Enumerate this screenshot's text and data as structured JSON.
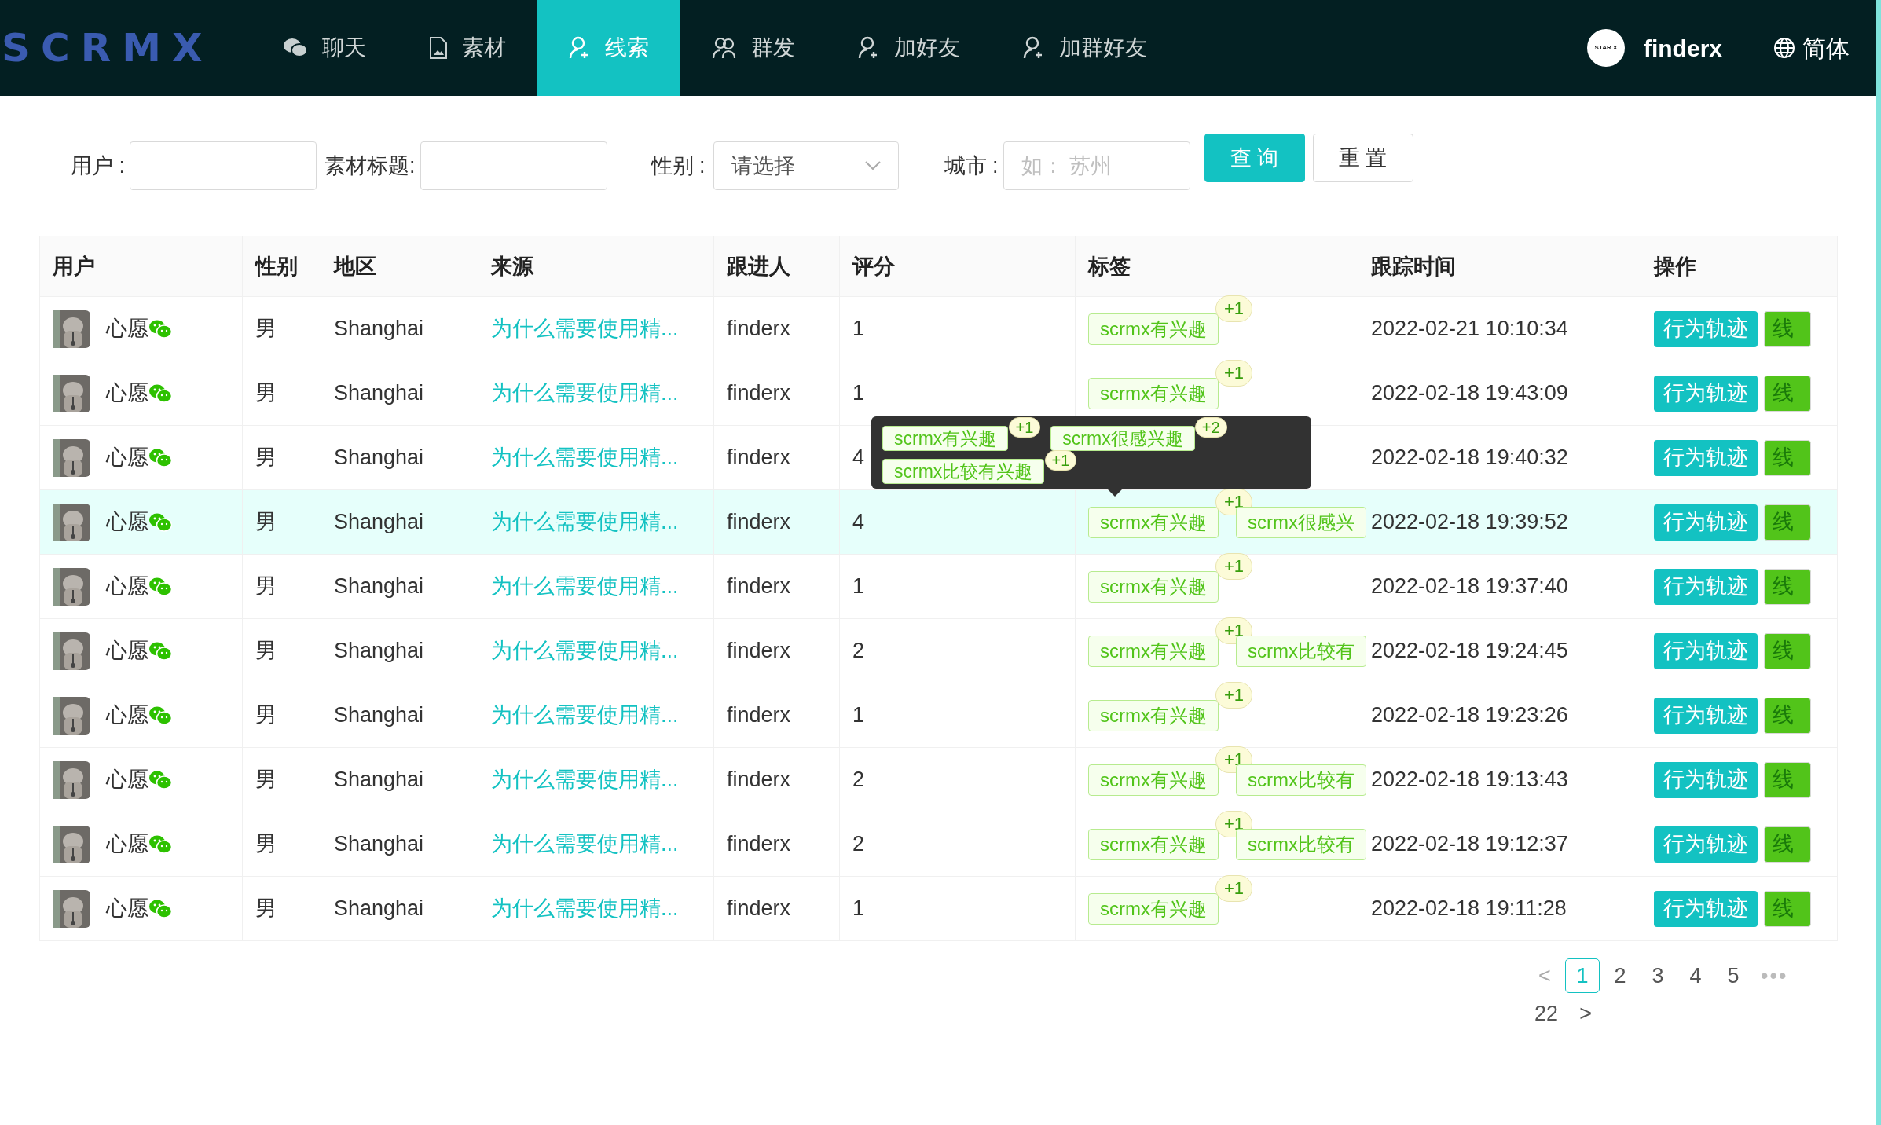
{
  "header": {
    "logo": "SCRMX",
    "nav": [
      {
        "label": "聊天",
        "selected": false
      },
      {
        "label": "素材",
        "selected": false
      },
      {
        "label": "线索",
        "selected": true
      },
      {
        "label": "群发",
        "selected": false
      },
      {
        "label": "加好友",
        "selected": false
      },
      {
        "label": "加群好友",
        "selected": false
      }
    ],
    "avatar_text": "STAR X",
    "user": "finderx",
    "language": "简体"
  },
  "filters": {
    "fields": [
      {
        "kind": "input",
        "label": "用户 :"
      },
      {
        "kind": "input",
        "label": "素材标题:"
      },
      {
        "kind": "select",
        "label": "性别 :",
        "value": "请选择"
      },
      {
        "kind": "input",
        "label": "城市 :",
        "placeholder": "如： 苏州"
      }
    ],
    "buttons": [
      "查 询",
      "重 置"
    ]
  },
  "table": {
    "columns": [
      "用户",
      "性别",
      "地区",
      "来源",
      "跟进人",
      "评分",
      "标签",
      "跟踪时间",
      "操作"
    ],
    "rows": [
      {
        "user": "心愿",
        "gender": "男",
        "region": "Shanghai",
        "source": "为什么需要使用精...",
        "follower": "finderx",
        "score": "1",
        "tags": [
          {
            "text": "scrmx有兴趣",
            "count": "+1"
          }
        ],
        "time": "2022-02-21 10:10:34",
        "actions": [
          "行为轨迹",
          "线"
        ],
        "highlighted": false
      },
      {
        "user": "心愿",
        "gender": "男",
        "region": "Shanghai",
        "source": "为什么需要使用精...",
        "follower": "finderx",
        "score": "1",
        "tags": [
          {
            "text": "scrmx有兴趣",
            "count": "+1"
          }
        ],
        "time": "2022-02-18 19:43:09",
        "actions": [
          "行为轨迹",
          "线"
        ],
        "highlighted": false
      },
      {
        "user": "心愿",
        "gender": "男",
        "region": "Shanghai",
        "source": "为什么需要使用精...",
        "follower": "finderx",
        "score": "4",
        "tags": [],
        "time": "2022-02-18 19:40:32",
        "actions": [
          "行为轨迹",
          "线"
        ],
        "highlighted": false
      },
      {
        "user": "心愿",
        "gender": "男",
        "region": "Shanghai",
        "source": "为什么需要使用精...",
        "follower": "finderx",
        "score": "4",
        "tags": [
          {
            "text": "scrmx有兴趣",
            "count": "+1"
          },
          {
            "text": "scrmx很感兴"
          }
        ],
        "time": "2022-02-18 19:39:52",
        "actions": [
          "行为轨迹",
          "线"
        ],
        "highlighted": true
      },
      {
        "user": "心愿",
        "gender": "男",
        "region": "Shanghai",
        "source": "为什么需要使用精...",
        "follower": "finderx",
        "score": "1",
        "tags": [
          {
            "text": "scrmx有兴趣",
            "count": "+1"
          }
        ],
        "time": "2022-02-18 19:37:40",
        "actions": [
          "行为轨迹",
          "线"
        ],
        "highlighted": false
      },
      {
        "user": "心愿",
        "gender": "男",
        "region": "Shanghai",
        "source": "为什么需要使用精...",
        "follower": "finderx",
        "score": "2",
        "tags": [
          {
            "text": "scrmx有兴趣",
            "count": "+1"
          },
          {
            "text": "scrmx比较有"
          }
        ],
        "time": "2022-02-18 19:24:45",
        "actions": [
          "行为轨迹",
          "线"
        ],
        "highlighted": false
      },
      {
        "user": "心愿",
        "gender": "男",
        "region": "Shanghai",
        "source": "为什么需要使用精...",
        "follower": "finderx",
        "score": "1",
        "tags": [
          {
            "text": "scrmx有兴趣",
            "count": "+1"
          }
        ],
        "time": "2022-02-18 19:23:26",
        "actions": [
          "行为轨迹",
          "线"
        ],
        "highlighted": false
      },
      {
        "user": "心愿",
        "gender": "男",
        "region": "Shanghai",
        "source": "为什么需要使用精...",
        "follower": "finderx",
        "score": "2",
        "tags": [
          {
            "text": "scrmx有兴趣",
            "count": "+1"
          },
          {
            "text": "scrmx比较有"
          }
        ],
        "time": "2022-02-18 19:13:43",
        "actions": [
          "行为轨迹",
          "线"
        ],
        "highlighted": false
      },
      {
        "user": "心愿",
        "gender": "男",
        "region": "Shanghai",
        "source": "为什么需要使用精...",
        "follower": "finderx",
        "score": "2",
        "tags": [
          {
            "text": "scrmx有兴趣",
            "count": "+1"
          },
          {
            "text": "scrmx比较有"
          }
        ],
        "time": "2022-02-18 19:12:37",
        "actions": [
          "行为轨迹",
          "线"
        ],
        "highlighted": false
      },
      {
        "user": "心愿",
        "gender": "男",
        "region": "Shanghai",
        "source": "为什么需要使用精...",
        "follower": "finderx",
        "score": "1",
        "tags": [
          {
            "text": "scrmx有兴趣",
            "count": "+1"
          }
        ],
        "time": "2022-02-18 19:11:28",
        "actions": [
          "行为轨迹",
          "线"
        ],
        "highlighted": false
      }
    ],
    "tooltip": {
      "tags": [
        {
          "text": "scrmx有兴趣",
          "count": "+1"
        },
        {
          "text": "scrmx很感兴趣",
          "count": "+2"
        },
        {
          "text": "scrmx比较有兴趣",
          "count": "+1"
        }
      ]
    }
  },
  "pagination": {
    "pages": [
      {
        "label": "1",
        "selected": true
      },
      {
        "label": "2",
        "selected": false
      },
      {
        "label": "3",
        "selected": false
      },
      {
        "label": "4",
        "selected": false
      },
      {
        "label": "5",
        "selected": false
      },
      {
        "label": "•••",
        "selected": false
      },
      {
        "label": "22",
        "selected": false
      }
    ],
    "prev": "<",
    "next": ">"
  }
}
